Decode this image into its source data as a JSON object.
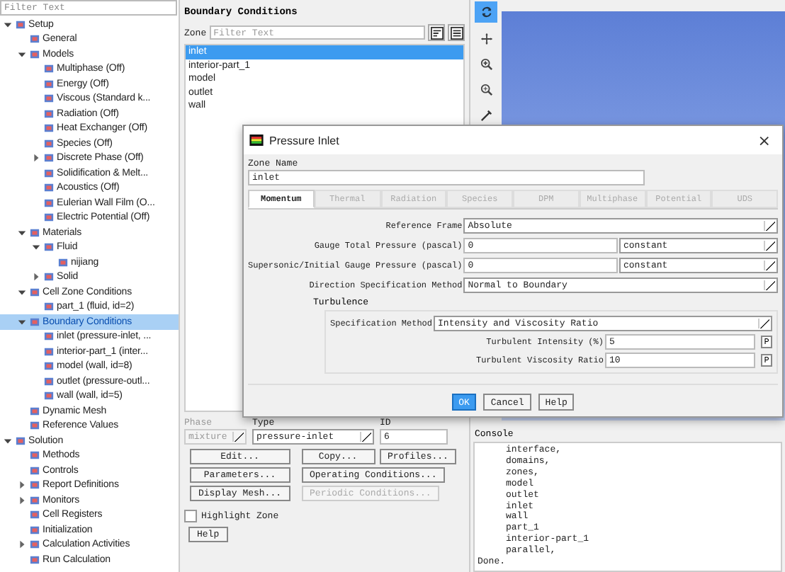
{
  "tree": {
    "filter_placeholder": "Filter Text",
    "items": [
      {
        "label": "Setup",
        "selected": false,
        "expanded": true,
        "children": [
          {
            "label": "General",
            "selected": false
          },
          {
            "label": "Models",
            "selected": false,
            "expanded": true,
            "children": [
              {
                "label": "Multiphase (Off)",
                "selected": false
              },
              {
                "label": "Energy (Off)",
                "selected": false
              },
              {
                "label": "Viscous (Standard k...",
                "selected": false
              },
              {
                "label": "Radiation (Off)",
                "selected": false
              },
              {
                "label": "Heat Exchanger (Off)",
                "selected": false
              },
              {
                "label": "Species (Off)",
                "selected": false
              },
              {
                "label": "Discrete Phase (Off)",
                "selected": false,
                "expanded": false
              },
              {
                "label": "Solidification & Melt...",
                "selected": false
              },
              {
                "label": "Acoustics (Off)",
                "selected": false
              },
              {
                "label": "Eulerian Wall Film (O...",
                "selected": false
              },
              {
                "label": "Electric Potential (Off)",
                "selected": false
              }
            ]
          },
          {
            "label": "Materials",
            "selected": false,
            "expanded": true,
            "children": [
              {
                "label": "Fluid",
                "selected": false,
                "expanded": true,
                "children": [
                  {
                    "label": "nijiang",
                    "selected": false
                  }
                ]
              },
              {
                "label": "Solid",
                "selected": false,
                "expanded": false
              }
            ]
          },
          {
            "label": "Cell Zone Conditions",
            "selected": false,
            "expanded": true,
            "children": [
              {
                "label": "part_1 (fluid, id=2)",
                "selected": false
              }
            ]
          },
          {
            "label": "Boundary Conditions",
            "selected": true,
            "expanded": true,
            "children": [
              {
                "label": "inlet (pressure-inlet, ...",
                "selected": false
              },
              {
                "label": "interior-part_1 (inter...",
                "selected": false
              },
              {
                "label": "model (wall, id=8)",
                "selected": false
              },
              {
                "label": "outlet (pressure-outl...",
                "selected": false
              },
              {
                "label": "wall (wall, id=5)",
                "selected": false
              }
            ]
          },
          {
            "label": "Dynamic Mesh",
            "selected": false
          },
          {
            "label": "Reference Values",
            "selected": false
          }
        ]
      },
      {
        "label": "Solution",
        "selected": false,
        "expanded": true,
        "children": [
          {
            "label": "Methods",
            "selected": false
          },
          {
            "label": "Controls",
            "selected": false
          },
          {
            "label": "Report Definitions",
            "selected": false,
            "expanded": false
          },
          {
            "label": "Monitors",
            "selected": false,
            "expanded": false
          },
          {
            "label": "Cell Registers",
            "selected": false
          },
          {
            "label": "Initialization",
            "selected": false
          },
          {
            "label": "Calculation Activities",
            "selected": false,
            "expanded": false
          },
          {
            "label": "Run Calculation",
            "selected": false
          }
        ]
      }
    ]
  },
  "boundary_panel": {
    "title": "Boundary Conditions",
    "zone_label": "Zone",
    "zone_placeholder": "Filter Text",
    "zones": [
      {
        "label": "inlet",
        "selected": true
      },
      {
        "label": "interior-part_1",
        "selected": false
      },
      {
        "label": "model",
        "selected": false
      },
      {
        "label": "outlet",
        "selected": false
      },
      {
        "label": "wall",
        "selected": false
      }
    ],
    "phase": {
      "label": "Phase",
      "value": "mixture",
      "disabled": true
    },
    "type": {
      "label": "Type",
      "value": "pressure-inlet"
    },
    "id": {
      "label": "ID",
      "value": "6"
    },
    "left_buttons": [
      {
        "label": "Edit...",
        "disabled": false
      },
      {
        "label": "Parameters...",
        "disabled": false
      },
      {
        "label": "Display Mesh...",
        "disabled": false
      }
    ],
    "right_button_rows": [
      [
        {
          "label": "Copy...",
          "disabled": false
        },
        {
          "label": "Profiles...",
          "disabled": false
        }
      ],
      [
        {
          "label": "Operating Conditions...",
          "disabled": false
        }
      ],
      [
        {
          "label": "Periodic Conditions...",
          "disabled": true
        }
      ]
    ],
    "highlight": {
      "label": "Highlight Zone",
      "checked": false
    },
    "help": "Help"
  },
  "toolbar": [
    {
      "kind": "rotate",
      "selected": true
    },
    {
      "kind": "pan",
      "selected": false
    },
    {
      "kind": "zoom_in",
      "selected": false
    },
    {
      "kind": "zoom_area",
      "selected": false
    },
    {
      "kind": "probe",
      "selected": false
    }
  ],
  "console": {
    "title": "Console",
    "lines": [
      {
        "text": "interface,",
        "indent": true
      },
      {
        "text": "domains,",
        "indent": true
      },
      {
        "text": "zones,",
        "indent": true
      },
      {
        "text": "model",
        "indent": true
      },
      {
        "text": "outlet",
        "indent": true
      },
      {
        "text": "inlet",
        "indent": true
      },
      {
        "text": "wall",
        "indent": true
      },
      {
        "text": "part_1",
        "indent": true
      },
      {
        "text": "interior-part_1",
        "indent": true
      },
      {
        "text": "parallel,",
        "indent": true
      },
      {
        "text": "Done.",
        "indent": false
      }
    ]
  },
  "dialog": {
    "title": "Pressure Inlet",
    "close": "×",
    "zone_name_label": "Zone Name",
    "zone_name": "inlet",
    "tabs": [
      {
        "label": "Momentum",
        "selected": true,
        "disabled": false
      },
      {
        "label": "Thermal",
        "selected": false,
        "disabled": true
      },
      {
        "label": "Radiation",
        "selected": false,
        "disabled": true
      },
      {
        "label": "Species",
        "selected": false,
        "disabled": true
      },
      {
        "label": "DPM",
        "selected": false,
        "disabled": true
      },
      {
        "label": "Multiphase",
        "selected": false,
        "disabled": true
      },
      {
        "label": "Potential",
        "selected": false,
        "disabled": true
      },
      {
        "label": "UDS",
        "selected": false,
        "disabled": true
      }
    ],
    "rows": [
      {
        "kind": "select",
        "label": "Reference Frame",
        "value": "Absolute"
      },
      {
        "kind": "input_select",
        "label": "Gauge Total Pressure (pascal)",
        "value": "0",
        "option": "constant"
      },
      {
        "kind": "input_select",
        "label": "Supersonic/Initial Gauge Pressure (pascal)",
        "value": "0",
        "option": "constant"
      },
      {
        "kind": "select",
        "label": "Direction Specification Method",
        "value": "Normal to Boundary"
      }
    ],
    "group": {
      "title": "Turbulence",
      "rows": [
        {
          "kind": "select",
          "label": "Specification Method",
          "value": "Intensity and Viscosity Ratio"
        },
        {
          "kind": "input_param",
          "label": "Turbulent Intensity (%)",
          "value": "5",
          "param": "P"
        },
        {
          "kind": "input_param",
          "label": "Turbulent Viscosity Ratio",
          "value": "10",
          "param": "P"
        }
      ]
    },
    "buttons": [
      {
        "label": "OK",
        "primary": true
      },
      {
        "label": "Cancel",
        "primary": false
      },
      {
        "label": "Help",
        "primary": false
      }
    ]
  }
}
